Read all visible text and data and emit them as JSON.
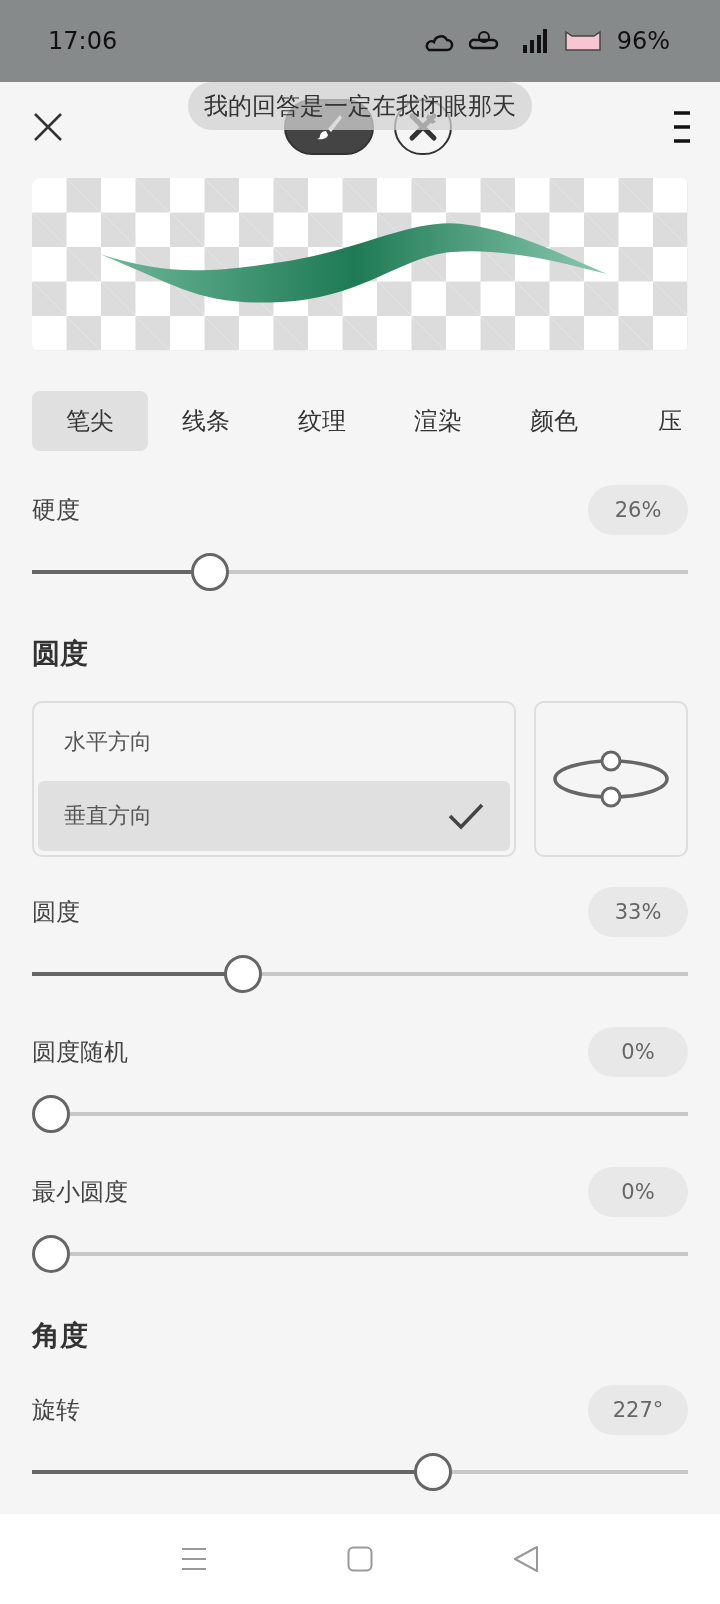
{
  "status_bar": {
    "time": "17:06",
    "battery": "96%"
  },
  "toast": "我的回答是一定在我闭眼那天",
  "mode_buttons": [
    {
      "kind": "brush",
      "selected": true
    },
    {
      "kind": "eraser",
      "selected": false
    }
  ],
  "tabs": [
    {
      "label": "笔尖",
      "selected": true
    },
    {
      "label": "线条",
      "selected": false
    },
    {
      "label": "纹理",
      "selected": false
    },
    {
      "label": "渲染",
      "selected": false
    },
    {
      "label": "颜色",
      "selected": false
    },
    {
      "label": "压",
      "selected": false
    }
  ],
  "settings": [
    {
      "kind": "slider",
      "label": "硬度",
      "reading": "26%",
      "level": 0.27
    },
    {
      "kind": "heading",
      "label": "圆度"
    },
    {
      "kind": "orientation",
      "options": [
        {
          "label": "水平方向",
          "selected": false
        },
        {
          "label": "垂直方向",
          "selected": true
        }
      ]
    },
    {
      "kind": "slider",
      "label": "圆度",
      "reading": "33%",
      "level": 0.32
    },
    {
      "kind": "slider",
      "label": "圆度随机",
      "reading": "0%",
      "level": 0
    },
    {
      "kind": "slider",
      "label": "最小圆度",
      "reading": "0%",
      "level": 0
    },
    {
      "kind": "heading",
      "label": "角度"
    },
    {
      "kind": "slider",
      "label": "旋转",
      "reading": "227°",
      "level": 0.61
    }
  ]
}
